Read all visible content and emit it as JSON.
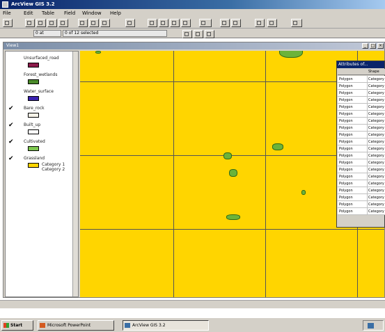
{
  "window": {
    "title": "ArcView GIS 3.2"
  },
  "menu": [
    "File",
    "Edit",
    "Table",
    "Field",
    "Window",
    "Help"
  ],
  "toolbar2": {
    "scale_field": "0 at",
    "selection_field": "0 of 12 selected"
  },
  "view": {
    "title": "View1"
  },
  "toc": {
    "layers": [
      {
        "label": "Unsurfaced_road",
        "checked": false,
        "color": "#8b1a4a"
      },
      {
        "label": "Forest_wetlands",
        "checked": false,
        "color": "#4a8a2a"
      },
      {
        "label": "Water_surface",
        "checked": false,
        "color": "#3a22b0"
      },
      {
        "label": "Bare_rock",
        "checked": true,
        "color": "#f7f3e8"
      },
      {
        "label": "Built_up",
        "checked": true,
        "color": "#ffffff"
      },
      {
        "label": "Cultivated",
        "checked": true,
        "color": "#7ec850"
      },
      {
        "label": "Grassland",
        "checked": true,
        "color": "#ffd500",
        "sub": [
          "Category 1",
          "Category 2"
        ]
      }
    ]
  },
  "attribute_table": {
    "title": "Attributes of...",
    "column": "Shape",
    "rows": [
      "Polygon",
      "Polygon",
      "Polygon",
      "Polygon",
      "Polygon",
      "Polygon",
      "Polygon",
      "Polygon",
      "Polygon",
      "Polygon",
      "Polygon",
      "Polygon",
      "Polygon",
      "Polygon",
      "Polygon",
      "Polygon",
      "Polygon",
      "Polygon",
      "Polygon",
      "Polygon"
    ],
    "cell": "Category"
  },
  "taskbar": {
    "start_label": "Start",
    "tasks": [
      {
        "label": "Microsoft PowerPoint",
        "active": false
      },
      {
        "label": "ArcView GIS 3.2",
        "active": true
      }
    ]
  },
  "colors": {
    "map_fill": "#ffd500",
    "blob": "#6cb33a",
    "blob_edge": "#2f6a18"
  }
}
